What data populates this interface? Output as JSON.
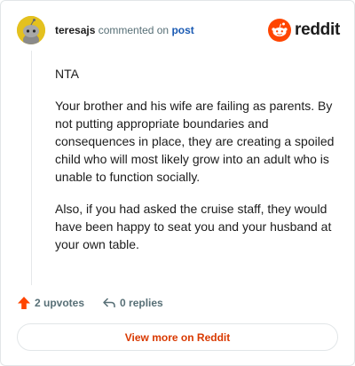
{
  "header": {
    "username": "teresajs",
    "action_text": "commented on",
    "post_link": "post",
    "brand": "reddit"
  },
  "comment": {
    "paragraphs": [
      "NTA",
      "Your brother and his wife are failing as parents. By not putting appropriate boundaries and consequences in place, they are creating a spoiled child who will most likely grow into an adult who is unable to function socially.",
      "Also, if you had asked the cruise staff, they would have been happy to seat you and your husband at your own table."
    ]
  },
  "actions": {
    "upvotes_label": "2 upvotes",
    "replies_label": "0 replies"
  },
  "footer": {
    "view_more_label": "View more on Reddit"
  },
  "colors": {
    "brand_orange": "#ff4500",
    "link_blue": "#1a5ab3",
    "view_more_text": "#d93900",
    "avatar_bg": "#e4c11f"
  },
  "icons": {
    "avatar": "snoo-avatar-icon",
    "logo": "reddit-logo-icon",
    "upvote": "upvote-arrow-icon",
    "reply": "reply-arrow-icon"
  }
}
